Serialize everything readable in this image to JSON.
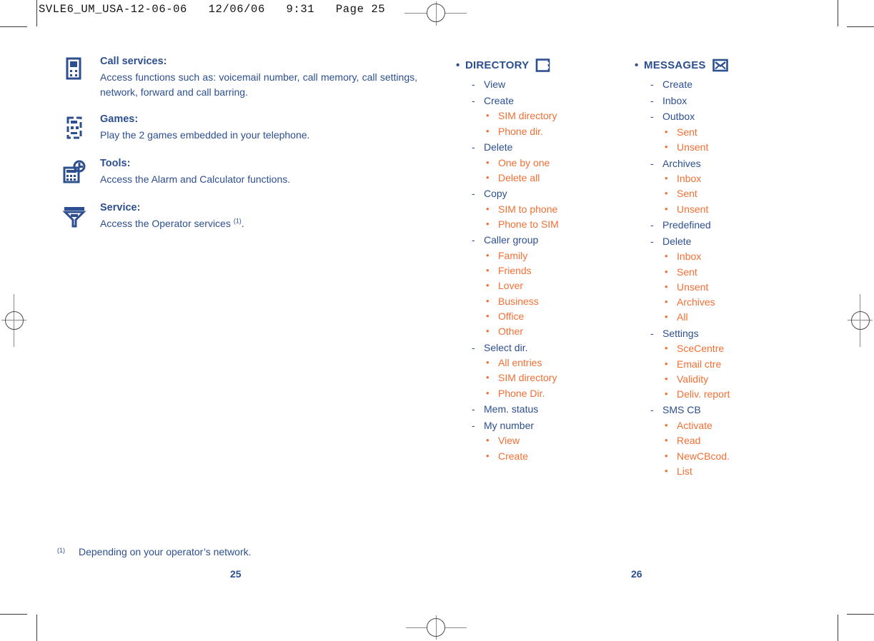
{
  "prepress": {
    "slug": "SVLE6_UM_USA-12-06-06   12/06/06   9:31   Page 25"
  },
  "left_column": {
    "features": [
      {
        "icon": "mobile-phone-icon",
        "title": "Call services:",
        "body": "Access functions such as: voicemail number, call memory, call settings, network, forward and call barring.",
        "justify": true
      },
      {
        "icon": "gamepad-icon",
        "title": "Games:",
        "body": "Play the 2 games embedded in your telephone.",
        "justify": false
      },
      {
        "icon": "calculator-alarm-icon",
        "title": "Tools:",
        "body": "Access the Alarm and Calculator functions.",
        "justify": false
      },
      {
        "icon": "operator-service-icon",
        "title": "Service:",
        "body_pre": "Access the Operator services ",
        "body_sup": "(1)",
        "body_post": ".",
        "justify": false
      }
    ]
  },
  "menu_columns": [
    {
      "id": "directory",
      "header": "DIRECTORY",
      "header_icon": "directory-book-icon",
      "items": [
        {
          "label": "View",
          "children": []
        },
        {
          "label": "Create",
          "children": [
            "SIM directory",
            "Phone dir."
          ]
        },
        {
          "label": "Delete",
          "children": [
            "One by one",
            "Delete all"
          ]
        },
        {
          "label": "Copy",
          "children": [
            "SIM to phone",
            "Phone to SIM"
          ]
        },
        {
          "label": "Caller group",
          "children": [
            "Family",
            "Friends",
            "Lover",
            "Business",
            "Office",
            "Other"
          ]
        },
        {
          "label": "Select dir.",
          "children": [
            "All entries",
            "SIM directory",
            "Phone Dir."
          ]
        },
        {
          "label": "Mem. status",
          "children": []
        },
        {
          "label": "My number",
          "children": [
            "View",
            "Create"
          ]
        }
      ]
    },
    {
      "id": "messages",
      "header": "MESSAGES",
      "header_icon": "envelope-icon",
      "items": [
        {
          "label": "Create",
          "children": []
        },
        {
          "label": "Inbox",
          "children": []
        },
        {
          "label": "Outbox",
          "children": [
            "Sent",
            "Unsent"
          ]
        },
        {
          "label": "Archives",
          "children": [
            "Inbox",
            "Sent",
            "Unsent"
          ]
        },
        {
          "label": "Predefined",
          "children": []
        },
        {
          "label": "Delete",
          "children": [
            "Inbox",
            "Sent",
            "Unsent",
            "Archives",
            "All"
          ]
        },
        {
          "label": "Settings",
          "children": [
            "SceCentre",
            "Email ctre",
            "Validity",
            "Deliv. report"
          ]
        },
        {
          "label": "SMS CB",
          "children": [
            "Activate",
            "Read",
            "NewCBcod.",
            "List"
          ]
        }
      ]
    }
  ],
  "footnote": {
    "mark": "(1)",
    "text": "Depending on your operator’s network."
  },
  "folios": {
    "left": "25",
    "right": "26"
  },
  "bullets": {
    "level1": "•",
    "level2": "-",
    "level3": "•"
  },
  "colors": {
    "blue": "#2d4f90",
    "orange": "#f26f34",
    "slug_black": "#111111"
  }
}
